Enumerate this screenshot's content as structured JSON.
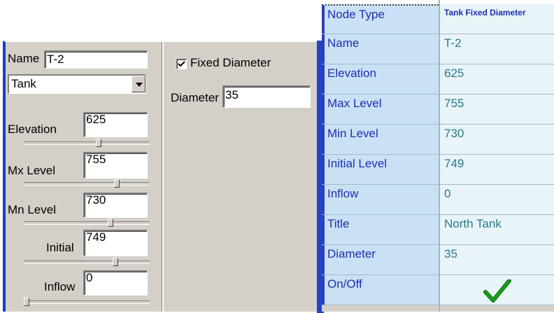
{
  "form": {
    "name_label": "Name",
    "name_value": "T-2",
    "node_type_value": "Tank",
    "elevation_label": "Elevation",
    "elevation_value": "625",
    "max_level_label": "Mx Level",
    "max_level_value": "755",
    "min_level_label": "Mn Level",
    "min_level_value": "730",
    "initial_label": "Initial",
    "initial_value": "749",
    "inflow_label": "Inflow",
    "inflow_value": "0",
    "fixed_diameter_label": "Fixed Diameter",
    "fixed_diameter_checked": true,
    "diameter_label": "Diameter",
    "diameter_value": "35",
    "sliders": {
      "elevation": 0.6,
      "max_level": 0.75,
      "min_level": 0.7,
      "initial": 0.74,
      "inflow": 0.0
    }
  },
  "grid": {
    "rows": [
      {
        "name": "Node Type",
        "value": "Tank Fixed Diameter"
      },
      {
        "name": "Name",
        "value": "T-2"
      },
      {
        "name": "Elevation",
        "value": "625"
      },
      {
        "name": "Max Level",
        "value": "755"
      },
      {
        "name": "Min Level",
        "value": "730"
      },
      {
        "name": "Initial Level",
        "value": "749"
      },
      {
        "name": "Inflow",
        "value": "0"
      },
      {
        "name": "Title",
        "value": "North Tank"
      },
      {
        "name": "Diameter",
        "value": "35"
      },
      {
        "name": "On/Off",
        "value": "check-icon"
      }
    ]
  },
  "colors": {
    "panel_bg": "#d4d0c8",
    "grid_name_bg": "#c9e1f4",
    "grid_value_bg": "#e8f4f8",
    "grid_name_text": "#1f2fb0",
    "grid_value_text": "#2a7a86",
    "check_green": "#1aa01a"
  }
}
